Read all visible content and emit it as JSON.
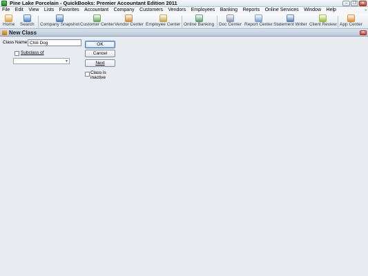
{
  "window": {
    "title": "Pine Lake Porcelain  - QuickBooks: Premier Accountant Edition 2011",
    "controls": [
      "minimize",
      "restore",
      "close"
    ]
  },
  "menu": [
    "File",
    "Edit",
    "View",
    "Lists",
    "Favorites",
    "Accountant",
    "Company",
    "Customers",
    "Vendors",
    "Employees",
    "Banking",
    "Reports",
    "Online Services",
    "Window",
    "Help"
  ],
  "menu_expand": "»",
  "toolbar": [
    {
      "label": "Home",
      "icon": "home-icon",
      "color": "#e0a23a"
    },
    {
      "label": "Search",
      "icon": "search-icon",
      "color": "#4a86c5"
    },
    {
      "label": "Company Snapshot",
      "icon": "company-snapshot-icon",
      "color": "#4b7fb8"
    },
    {
      "label": "Customer Center",
      "icon": "customer-center-icon",
      "color": "#6aa65d"
    },
    {
      "label": "Vendor Center",
      "icon": "vendor-center-icon",
      "color": "#d08b3c"
    },
    {
      "label": "Employee Center",
      "icon": "employee-center-icon",
      "color": "#c9a348"
    },
    {
      "label": "Online Banking",
      "icon": "online-banking-icon",
      "color": "#5e9f6b"
    },
    {
      "label": "Doc Center",
      "icon": "doc-center-icon",
      "color": "#8a98aa"
    },
    {
      "label": "Report Center",
      "icon": "report-center-icon",
      "color": "#7aa0c8"
    },
    {
      "label": "Statement Writer",
      "icon": "statement-writer-icon",
      "color": "#5a84b0"
    },
    {
      "label": "Client Review",
      "icon": "client-review-icon",
      "color": "#9cbc3a"
    },
    {
      "label": "App Center",
      "icon": "app-center-icon",
      "color": "#e08a2c"
    }
  ],
  "dialog": {
    "title": "New Class",
    "class_name_label": "Class Name",
    "class_name_value": "Chili Dog",
    "subclass_label": "Subclass of",
    "subclass_checked": false,
    "subclass_value": "",
    "inactive_label_1": "Class is",
    "inactive_label_2": "inactive",
    "inactive_checked": false,
    "ok_label": "OK",
    "cancel_label": "Cancel",
    "next_label": "Next"
  }
}
